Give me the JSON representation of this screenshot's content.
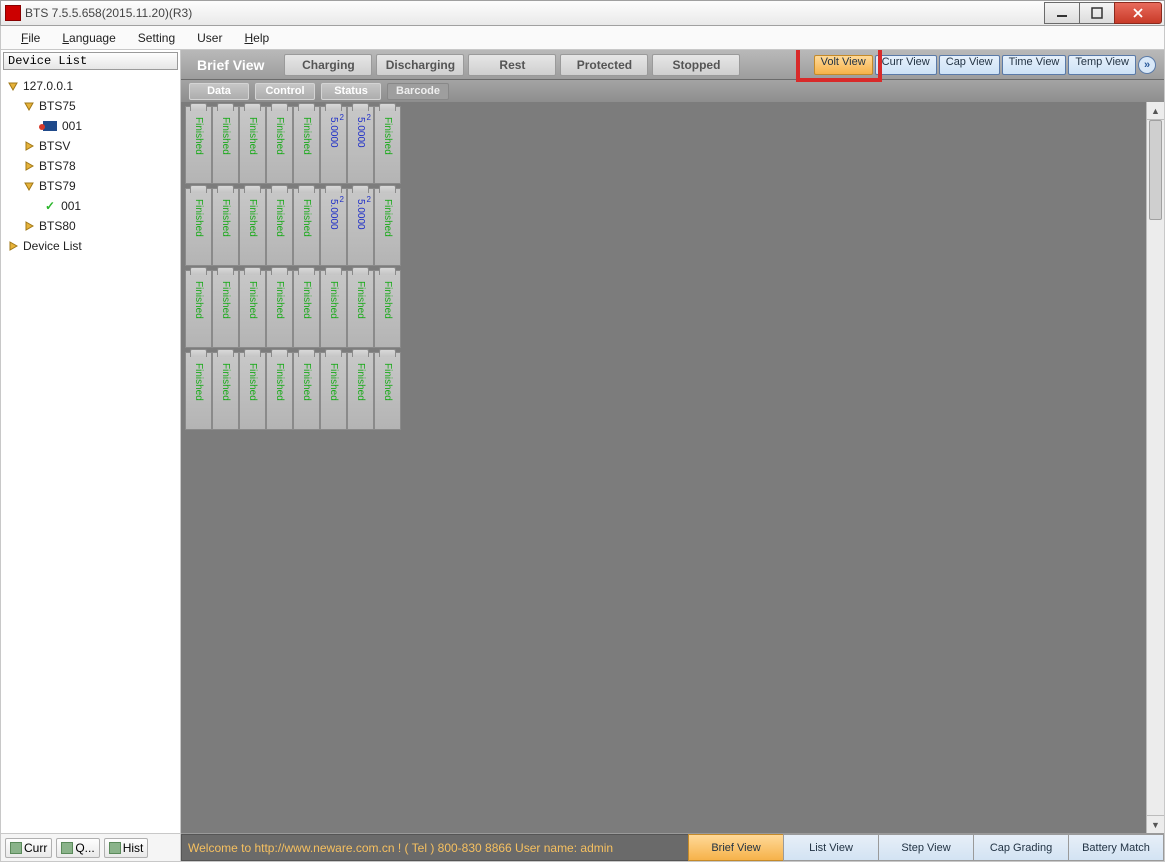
{
  "window": {
    "title": "BTS 7.5.5.658(2015.11.20)(R3)"
  },
  "menus": {
    "file": "File",
    "language": "Language",
    "setting": "Setting",
    "user": "User",
    "help": "Help"
  },
  "left": {
    "header": "Device List",
    "tree": {
      "root": "127.0.0.1",
      "bts75": "BTS75",
      "bts75_001": "001",
      "btsv": "BTSV",
      "bts78": "BTS78",
      "bts79": "BTS79",
      "bts79_001": "001",
      "bts80": "BTS80",
      "devicelist": "Device List"
    },
    "bottombtns": {
      "curr": "Curr",
      "q": "Q...",
      "hist": "Hist"
    }
  },
  "top": {
    "brief": "Brief View",
    "filters": {
      "charging": "Charging",
      "discharging": "Discharging",
      "rest": "Rest",
      "protected": "Protected",
      "stopped": "Stopped"
    },
    "views": {
      "volt": "Volt View",
      "curr": "Curr View",
      "cap": "Cap View",
      "time": "Time View",
      "temp": "Temp View"
    }
  },
  "subtabs": {
    "data": "Data",
    "control": "Control",
    "status": "Status",
    "barcode": "Barcode"
  },
  "cell": {
    "finished": "Finished",
    "volt": "5.0000",
    "idx": "2"
  },
  "status": {
    "msg": "Welcome to http://www.neware.com.cn !    ( Tel ) 800-830 8866  User name: admin",
    "brief": "Brief View",
    "list": "List View",
    "step": "Step View",
    "cap": "Cap Grading",
    "batt": "Battery Match"
  }
}
